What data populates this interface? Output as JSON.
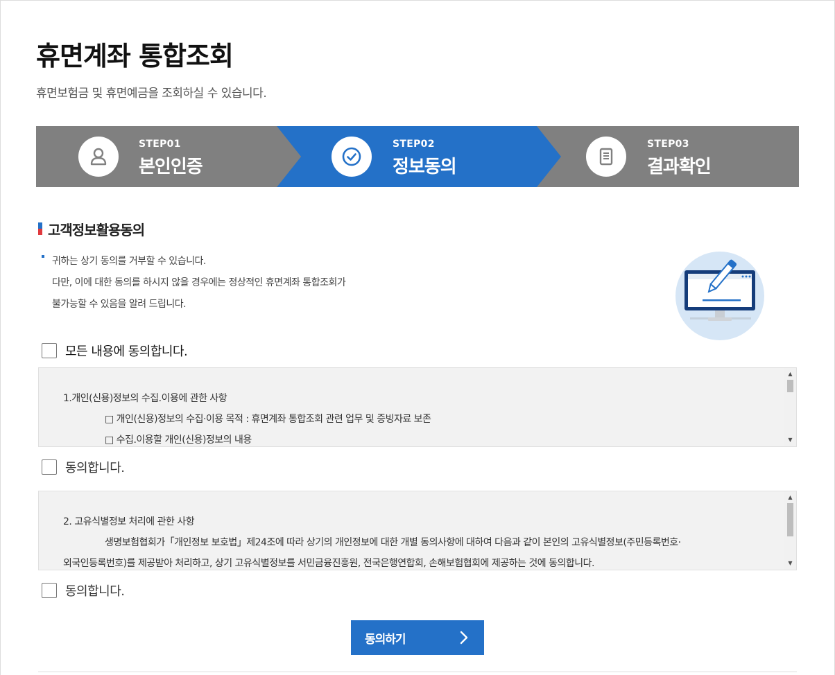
{
  "header": {
    "title": "휴면계좌 통합조회",
    "subtitle": "휴면보험금 및 휴면예금을 조회하실 수 있습니다."
  },
  "steps": [
    {
      "num": "STEP01",
      "label": "본인인증",
      "icon": "person-icon",
      "active": false
    },
    {
      "num": "STEP02",
      "label": "정보동의",
      "icon": "check-circle-icon",
      "active": true
    },
    {
      "num": "STEP03",
      "label": "결과확인",
      "icon": "document-icon",
      "active": false
    }
  ],
  "section": {
    "title": "고객정보활용동의",
    "notice": [
      "귀하는 상기 동의를 거부할 수 있습니다.",
      "다만, 이에 대한 동의를 하시지 않을 경우에는 정상적인 휴면계좌 통합조회가",
      "불가능할 수 있음을 알려 드립니다."
    ],
    "illustration": "monitor-pen-icon"
  },
  "agree_all": {
    "label": "모든 내용에 동의합니다.",
    "checked": false
  },
  "terms1": {
    "heading": "1.개인(신용)정보의 수집.이용에 관한 사항",
    "line1": "□ 개인(신용)정보의 수집·이용 목적 : 휴면계좌 통합조회 관련 업무 및 증빙자료 보존",
    "line2": "□ 수집.이용할 개인(신용)정보의 내용",
    "agree_label": "동의합니다.",
    "checked": false
  },
  "terms2": {
    "heading": "2. 고유식별정보 처리에 관한 사항",
    "line1": "생명보험협회가「개인정보 보호법」제24조에 따라 상기의 개인정보에 대한 개별 동의사항에 대하여 다음과 같이 본인의 고유식별정보(주민등록번호·",
    "line2": "외국인등록번호)를 제공받아 처리하고, 상기 고유식별정보를  서민금융진흥원, 전국은행연합회, 손해보험협회에 제공하는 것에 동의합니다.",
    "agree_label": "동의합니다.",
    "checked": false
  },
  "submit": {
    "label": "동의하기",
    "icon": "chevron-right-icon"
  },
  "colors": {
    "accent": "#2471c8",
    "step_gray": "#808080",
    "terms_bg": "#f2f2f2",
    "mark_red": "#e0393e"
  }
}
